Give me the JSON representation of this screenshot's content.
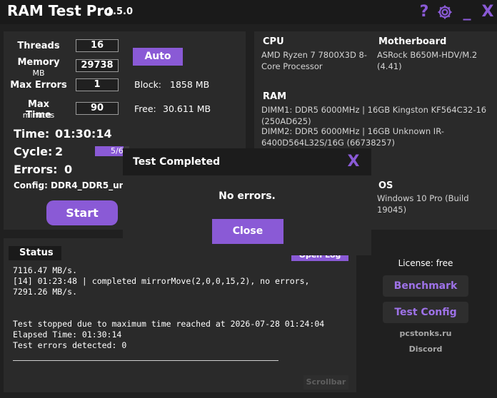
{
  "window": {
    "title": "RAM Test Pro",
    "version": "1.5.0",
    "help_glyph": "?",
    "minimize_glyph": "_",
    "close_glyph": "X",
    "accent_color": "#8a5ad6"
  },
  "settings": {
    "threads_label": "Threads",
    "threads_value": "16",
    "memory_label": "Memory",
    "memory_unit": "MB",
    "memory_value": "29738",
    "max_errors_label": "Max Errors",
    "max_errors_value": "1",
    "max_time_label": "Max Time",
    "max_time_unit": "minutes",
    "max_time_value": "90",
    "auto_button": "Auto",
    "block_label": "Block:",
    "block_value": "1858 MB",
    "free_label": "Free:",
    "free_value": "30.611 MB"
  },
  "stats": {
    "time_label": "Time:",
    "time_value": "01:30:14",
    "cycle_label": "Cycle:",
    "cycle_value": "2",
    "progress_text": "5/6",
    "progress_fraction": 0.833,
    "errors_label": "Errors:",
    "errors_value": "0",
    "config_text": "Config: DDR4_DDR5_universal",
    "start_button": "Start"
  },
  "system_info": {
    "cpu_label": "CPU",
    "cpu_value": "AMD Ryzen 7 7800X3D 8-Core Processor",
    "motherboard_label": "Motherboard",
    "motherboard_value": "ASRock B650M-HDV/M.2 (4.41)",
    "ram_label": "RAM",
    "dimm1": "DIMM1: DDR5 6000MHz | 16GB Kingston KF564C32-16 (250AD625)",
    "dimm2": "DIMM2: DDR5 6000MHz | 16GB Unknown IR-6400D564L32S/16G (66738257)",
    "os_label": "OS",
    "os_value": "Windows 10 Pro (Build 19045)"
  },
  "status": {
    "tab_label": "Status",
    "open_log_button": "Open Log",
    "log_lines": [
      "7116.47 MB/s.",
      "[14] 01:23:48 | completed mirrorMove(2,0,0,15,2), no errors,",
      "7291.26 MB/s.",
      "",
      "",
      "Test stopped due to maximum time reached at 2026-07-28 01:24:04",
      "Elapsed Time: 01:30:14",
      "Test errors detected: 0"
    ],
    "scrollbar_label": "Scrollbar"
  },
  "side": {
    "license_text": "License: free",
    "benchmark_button": "Benchmark",
    "test_config_button": "Test Config",
    "site_link": "pcstonks.ru",
    "discord_link": "Discord"
  },
  "modal": {
    "title": "Test Completed",
    "close_glyph": "X",
    "message": "No errors.",
    "close_button": "Close"
  }
}
